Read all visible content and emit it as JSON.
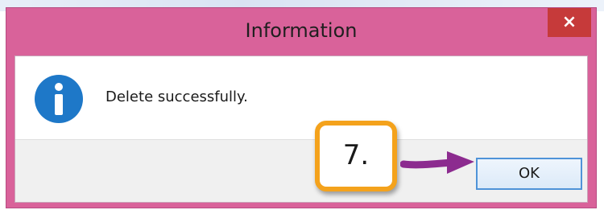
{
  "dialog": {
    "title": "Information",
    "close_glyph": "×",
    "message": "Delete successfully.",
    "icon": "info-icon",
    "ok_label": "OK"
  },
  "annotation": {
    "step_label": "7.",
    "arrow_color": "#8c2b8f",
    "callout_border_color": "#f4a21c"
  },
  "colors": {
    "title_bar": "#d9629a",
    "close_button": "#c63a3a",
    "info_icon_blue": "#1e78c8",
    "ok_button_border": "#4f93d8"
  }
}
